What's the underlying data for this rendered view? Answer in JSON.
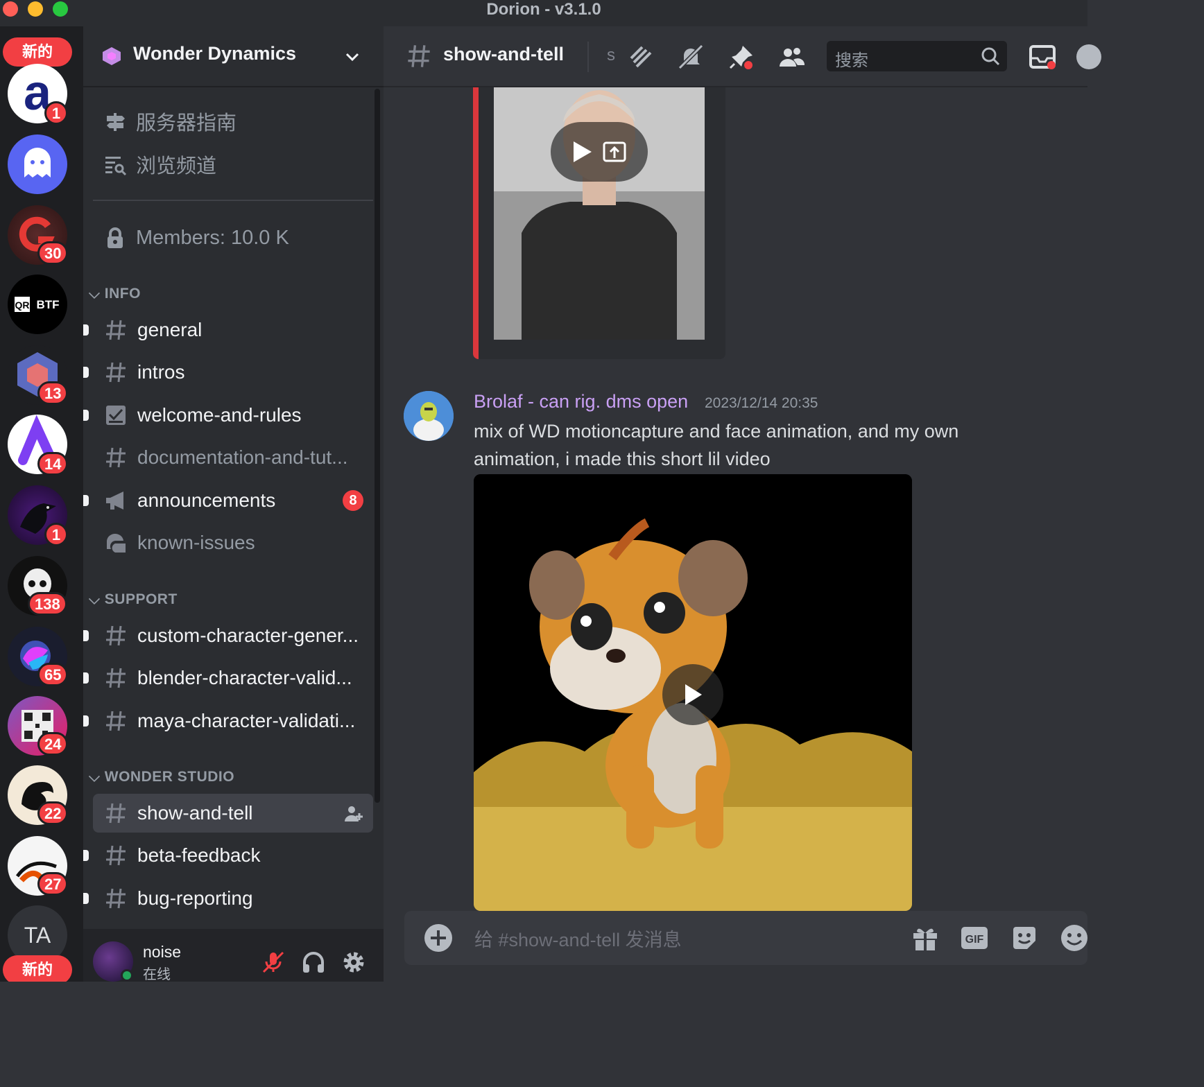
{
  "window": {
    "title": "Dorion - v3.1.0"
  },
  "server_rail": {
    "new_label_top": "新的",
    "new_label_bottom": "新的",
    "servers": [
      {
        "name": "a",
        "badge": "1"
      },
      {
        "name": "ghost",
        "badge": ""
      },
      {
        "name": "G",
        "badge": "30"
      },
      {
        "name": "QRBTF",
        "badge": ""
      },
      {
        "name": "cube",
        "badge": "13"
      },
      {
        "name": "A",
        "badge": "14"
      },
      {
        "name": "crow",
        "badge": "1"
      },
      {
        "name": "skull",
        "badge": "138"
      },
      {
        "name": "orb",
        "badge": "65"
      },
      {
        "name": "qr",
        "badge": "24"
      },
      {
        "name": "bird",
        "badge": "22"
      },
      {
        "name": "swirl",
        "badge": "27"
      },
      {
        "name": "TA",
        "badge": ""
      }
    ]
  },
  "sidebar": {
    "guild_name": "Wonder Dynamics",
    "nav": {
      "server_guide": "服务器指南",
      "browse_channels": "浏览频道",
      "members": "Members: 10.0 K"
    },
    "categories": {
      "info": "INFO",
      "support": "SUPPORT",
      "studio": "WONDER STUDIO"
    },
    "channels": {
      "general": "general",
      "intros": "intros",
      "welcome": "welcome-and-rules",
      "docs": "documentation-and-tut...",
      "announcements": "announcements",
      "announcements_mentions": "8",
      "known_issues": "known-issues",
      "custom": "custom-character-gener...",
      "blender": "blender-character-valid...",
      "maya": "maya-character-validati...",
      "show_and_tell": "show-and-tell",
      "beta": "beta-feedback",
      "bug": "bug-reporting"
    }
  },
  "user_panel": {
    "name": "noise",
    "status": "在线"
  },
  "chat_header": {
    "channel": "show-and-tell",
    "topic_fragment": "s",
    "search_placeholder": "搜索"
  },
  "message": {
    "author": "Brolaf - can rig. dms open",
    "timestamp": "2023/12/14 20:35",
    "text": "mix of WD motioncapture and face animation, and my own animation, i made this short lil video"
  },
  "composer": {
    "placeholder": "给 #show-and-tell 发消息",
    "gif_label": "GIF"
  },
  "colors": {
    "accent_red": "#f23f43",
    "author_color": "#c9a0f4",
    "online_green": "#23a55a"
  }
}
